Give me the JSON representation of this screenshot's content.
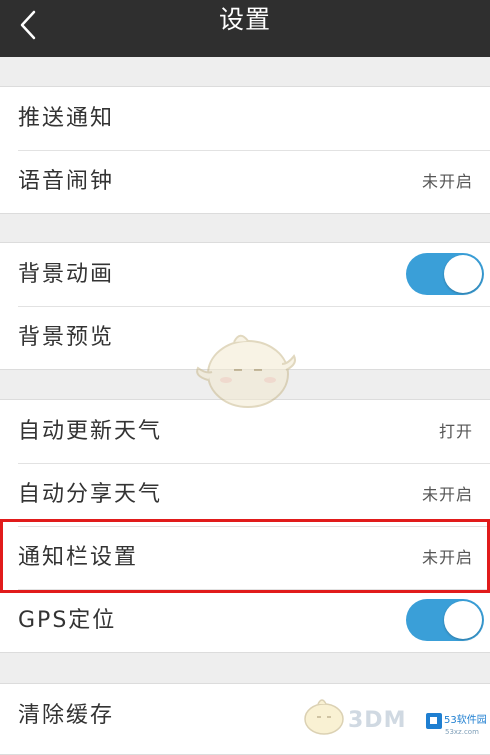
{
  "header": {
    "title": "设置",
    "back_icon": "chevron-left-icon"
  },
  "groups": [
    {
      "items": [
        {
          "label": "推送通知",
          "status": ""
        },
        {
          "label": "语音闹钟",
          "status": "未开启"
        }
      ]
    },
    {
      "items": [
        {
          "label": "背景动画",
          "toggle": true
        },
        {
          "label": "背景预览",
          "status": ""
        }
      ]
    },
    {
      "items": [
        {
          "label": "自动更新天气",
          "status": "打开"
        },
        {
          "label": "自动分享天气",
          "status": "未开启"
        },
        {
          "label": "通知栏设置",
          "status": "未开启",
          "highlighted": true
        },
        {
          "label": "GPS定位",
          "toggle": true
        }
      ]
    },
    {
      "items": [
        {
          "label": "清除缓存",
          "status": ""
        }
      ]
    }
  ],
  "watermark": {
    "brand": "3DM",
    "badge_text": "53软件园",
    "url": "53xz.com"
  },
  "colors": {
    "header_bg": "#2f2f2f",
    "toggle_on": "#3a9fd8",
    "highlight_border": "#e11b1b",
    "page_bg": "#eeeeee"
  }
}
